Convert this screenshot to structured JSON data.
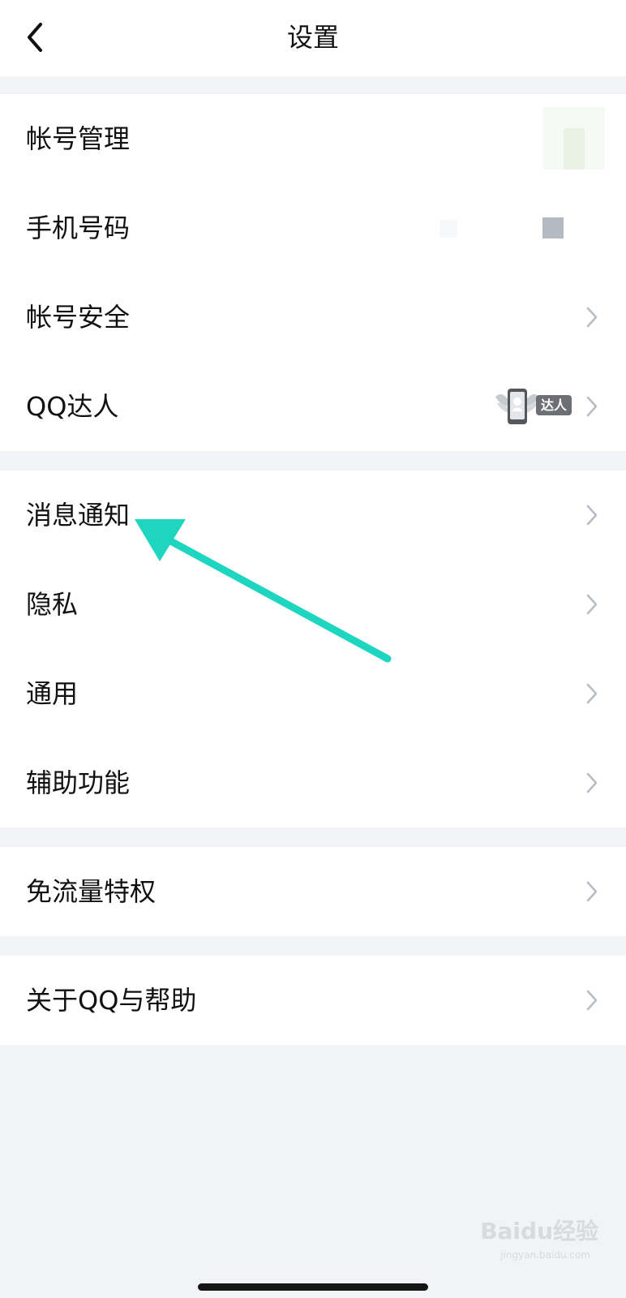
{
  "header": {
    "title": "设置",
    "back_icon": "chevron-left-icon"
  },
  "groups": [
    {
      "items": [
        {
          "label": "帐号管理",
          "accessory": "avatar"
        },
        {
          "label": "手机号码",
          "accessory": "masked-value"
        },
        {
          "label": "帐号安全",
          "accessory": "chevron-right-icon"
        },
        {
          "label": "QQ达人",
          "accessory": "qq-daren-badge",
          "badge_text": "达人"
        }
      ]
    },
    {
      "items": [
        {
          "label": "消息通知",
          "accessory": "chevron-right-icon"
        },
        {
          "label": "隐私",
          "accessory": "chevron-right-icon"
        },
        {
          "label": "通用",
          "accessory": "chevron-right-icon"
        },
        {
          "label": "辅助功能",
          "accessory": "chevron-right-icon"
        }
      ]
    },
    {
      "items": [
        {
          "label": "免流量特权",
          "accessory": "chevron-right-icon"
        }
      ]
    },
    {
      "items": [
        {
          "label": "关于QQ与帮助",
          "accessory": "chevron-right-icon"
        }
      ]
    }
  ],
  "annotation": {
    "icon": "arrow-pointer-icon",
    "color": "#1ed6c0",
    "points_to": "消息通知"
  },
  "watermark": {
    "text": "Baidu经验",
    "url": "jingyan.baidu.com"
  },
  "colors": {
    "page_background": "#f2f3f6",
    "row_background": "#ffffff",
    "text": "#111111",
    "chevron": "#b8bcc4"
  }
}
